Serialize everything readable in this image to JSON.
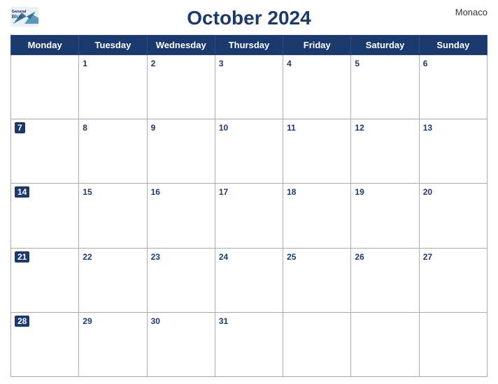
{
  "logo": {
    "general": "General",
    "blue": "Blue"
  },
  "title": "October 2024",
  "country": "Monaco",
  "days": [
    "Monday",
    "Tuesday",
    "Wednesday",
    "Thursday",
    "Friday",
    "Saturday",
    "Sunday"
  ],
  "weeks": [
    [
      null,
      1,
      2,
      3,
      4,
      5,
      6
    ],
    [
      7,
      8,
      9,
      10,
      11,
      12,
      13
    ],
    [
      14,
      15,
      16,
      17,
      18,
      19,
      20
    ],
    [
      21,
      22,
      23,
      24,
      25,
      26,
      27
    ],
    [
      28,
      29,
      30,
      31,
      null,
      null,
      null
    ]
  ]
}
